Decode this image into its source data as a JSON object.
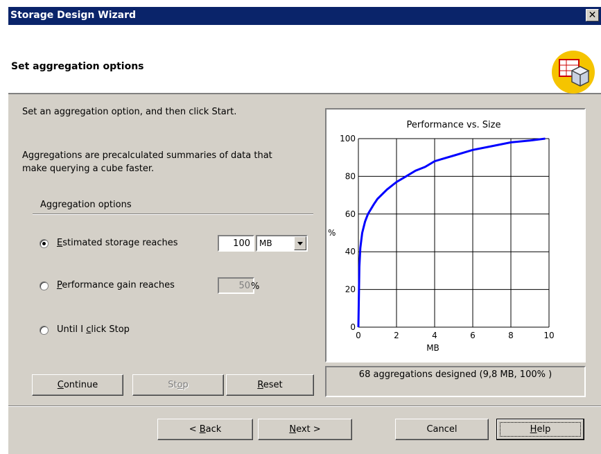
{
  "window": {
    "title": "Storage Design Wizard",
    "close_glyph": "✕",
    "header_title": "Set aggregation options",
    "header_icon": "cube-chart-icon"
  },
  "intro": {
    "line1": "Set an aggregation option, and then click Start.",
    "line2": "Aggregations are precalculated summaries of data that",
    "line3": "make querying a cube faster."
  },
  "options": {
    "group_label": "Aggregation options",
    "estimated_storage": {
      "label": "Estimated storage reaches",
      "selected": true,
      "value": "100",
      "unit": "MB"
    },
    "performance_gain": {
      "label": "Performance gain reaches",
      "selected": false,
      "value": "50",
      "unit": "%"
    },
    "until_stop": {
      "label": "Until I click Stop",
      "selected": false
    }
  },
  "action_buttons": {
    "continue": "Continue",
    "stop": "Stop",
    "reset": "Reset"
  },
  "status": {
    "text": "68 aggregations designed (9,8 MB, 100% )"
  },
  "nav_buttons": {
    "back": "< Back",
    "next": "Next >",
    "cancel": "Cancel",
    "help": "Help"
  },
  "chart_data": {
    "type": "line",
    "title": "Performance vs. Size",
    "xlabel": "MB",
    "ylabel": "%",
    "xlim": [
      0,
      10
    ],
    "ylim": [
      0,
      100
    ],
    "xticks": [
      0,
      2,
      4,
      6,
      8,
      10
    ],
    "yticks": [
      0,
      20,
      40,
      60,
      80,
      100
    ],
    "grid": true,
    "series": [
      {
        "color": "#0000ff",
        "x": [
          0,
          0.05,
          0.1,
          0.2,
          0.35,
          0.5,
          0.8,
          1.0,
          1.5,
          2.0,
          2.5,
          3.0,
          3.5,
          4.0,
          5.0,
          6.0,
          7.0,
          8.0,
          9.0,
          9.8
        ],
        "y": [
          0,
          32,
          42,
          50,
          56,
          60,
          65,
          68,
          73,
          77,
          80,
          83,
          85,
          88,
          91,
          94,
          96,
          98,
          99,
          100
        ]
      }
    ]
  }
}
